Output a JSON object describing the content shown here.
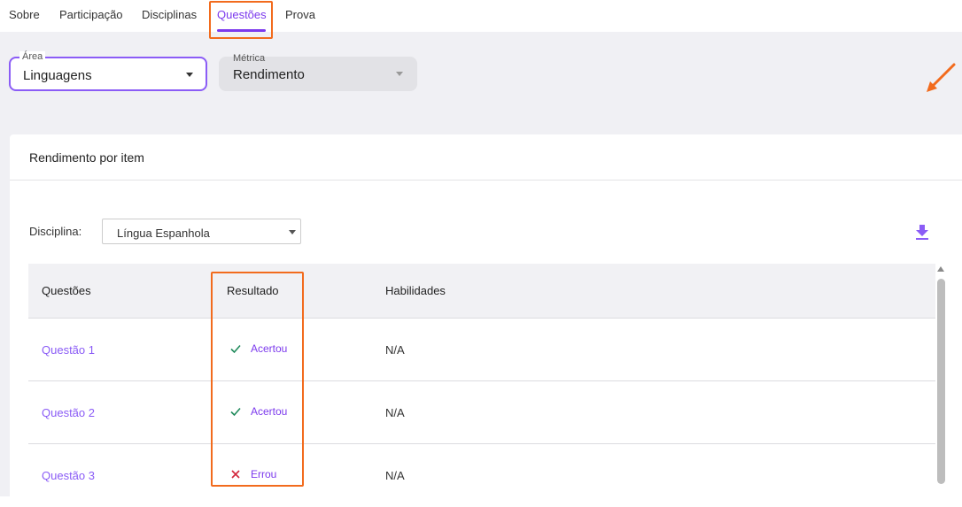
{
  "tabs": [
    {
      "label": "Sobre"
    },
    {
      "label": "Participação"
    },
    {
      "label": "Disciplinas"
    },
    {
      "label": "Questões"
    },
    {
      "label": "Prova"
    }
  ],
  "filters": {
    "area": {
      "label": "Área",
      "value": "Linguagens"
    },
    "metrica": {
      "label": "Métrica",
      "value": "Rendimento"
    }
  },
  "card": {
    "title": "Rendimento por item",
    "disciplina_label": "Disciplina:",
    "disciplina_value": "Língua Espanhola"
  },
  "table": {
    "headers": [
      "Questões",
      "Resultado",
      "Habilidades"
    ],
    "rows": [
      {
        "questao": "Questão 1",
        "resultado": "Acertou",
        "status": "correct",
        "habilidades": "N/A"
      },
      {
        "questao": "Questão 2",
        "resultado": "Acertou",
        "status": "correct",
        "habilidades": "N/A"
      },
      {
        "questao": "Questão 3",
        "resultado": "Errou",
        "status": "wrong",
        "habilidades": "N/A"
      }
    ]
  },
  "colors": {
    "accent": "#7c3aed",
    "highlight": "#f26b1d",
    "correct": "#1f8a5b",
    "wrong": "#d2273c"
  },
  "icons": {
    "download": "download-icon",
    "correct": "check-icon",
    "wrong": "close-icon",
    "caret": "caret-down-icon"
  }
}
